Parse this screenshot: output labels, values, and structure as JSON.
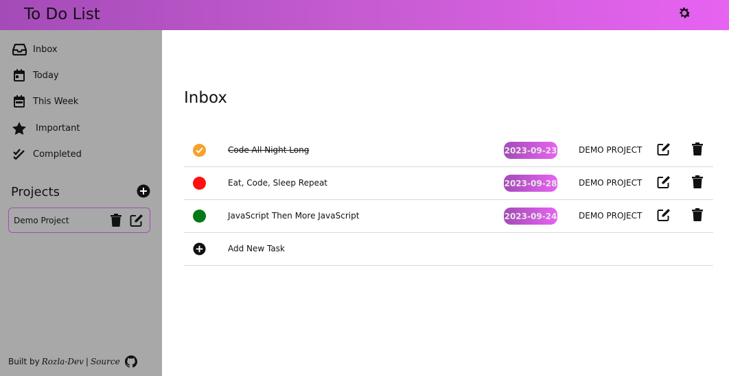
{
  "header": {
    "title": "To Do List"
  },
  "sidebar": {
    "items": [
      {
        "label": "Inbox",
        "icon": "inbox-icon"
      },
      {
        "label": "Today",
        "icon": "calendar-day-icon"
      },
      {
        "label": "This Week",
        "icon": "calendar-week-icon"
      },
      {
        "label": "Important",
        "icon": "star-icon"
      },
      {
        "label": "Completed",
        "icon": "double-check-icon"
      }
    ],
    "projects_title": "Projects",
    "projects": [
      {
        "name": "Demo Project"
      }
    ]
  },
  "footer": {
    "built_by": "Built by",
    "author": "Rozla-Dev",
    "separator": "|",
    "source": "Source"
  },
  "main": {
    "title": "Inbox",
    "tasks": [
      {
        "title": "Code All Night Long",
        "date": "2023-09-23",
        "project": "DEMO PROJECT",
        "done": true,
        "status_color": "#f7a12c"
      },
      {
        "title": "Eat, Code, Sleep Repeat",
        "date": "2023-09-28",
        "project": "DEMO PROJECT",
        "done": false,
        "status_color": "#ff0f0f"
      },
      {
        "title": "JavaScript Then More JavaScript",
        "date": "2023-09-24",
        "project": "DEMO PROJECT",
        "done": false,
        "status_color": "#047a16"
      }
    ],
    "add_task_label": "Add New Task"
  },
  "colors": {
    "accent_start": "#a44bb8",
    "accent_end": "#e763f2",
    "sidebar_bg": "#a8a8a8"
  }
}
